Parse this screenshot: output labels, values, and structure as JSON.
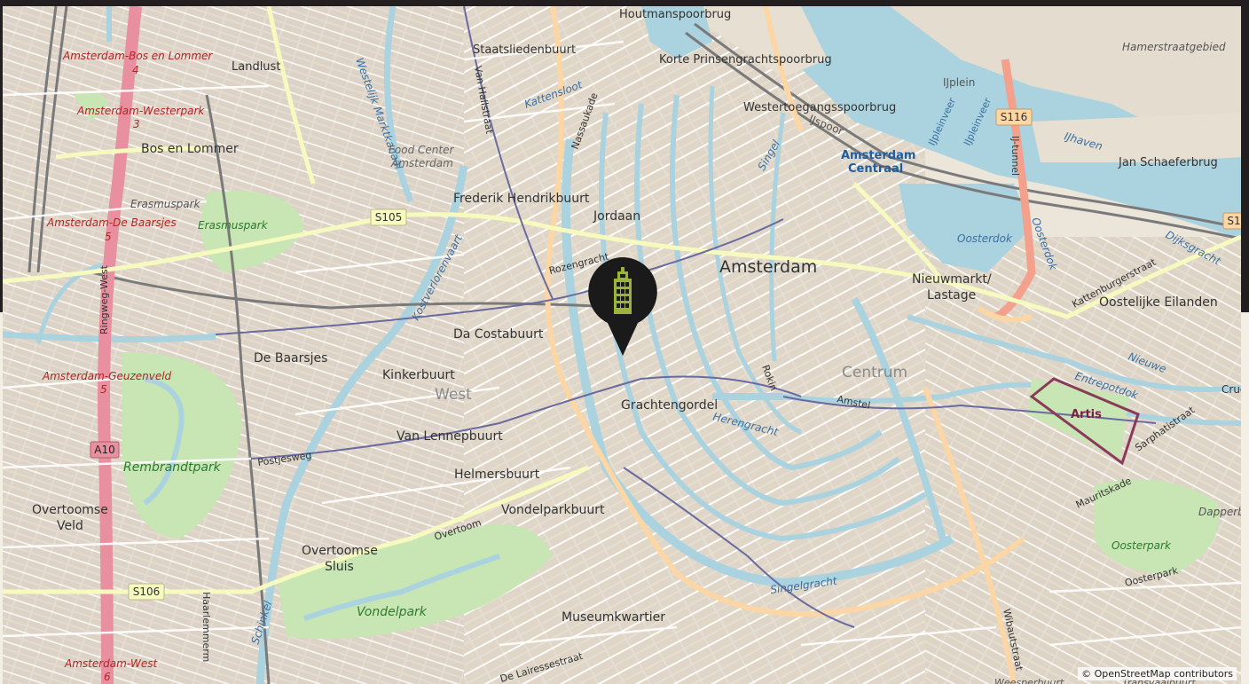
{
  "map": {
    "attribution": "© OpenStreetMap contributors",
    "marker_icon": "building-marker-icon",
    "colors": {
      "land": "#ece6da",
      "water": "#aad3df",
      "park": "#c8e5b4",
      "motorway": "#e8909f",
      "primary": "#fcd6a4",
      "secondary": "#f7fabf",
      "rail": "#7a7a7a",
      "marker": "#1a1a1a",
      "marker_icon": "#9cb33b"
    },
    "road_badges": {
      "s105": "S105",
      "s106": "S106",
      "s116": "S116",
      "a10": "A10",
      "s1": "S1"
    },
    "labels": {
      "houtmanspoorbrug": "Houtmanspoorbrug",
      "staatsliedenbuurt": "Staatsliedenbuurt",
      "landlust": "Landlust",
      "station_bos_lommer": "Amsterdam-Bos en Lommer",
      "station_bos_lommer_num": "4",
      "station_westerpark": "Amsterdam-Westerpark",
      "station_westerpark_num": "3",
      "bos_en_lommer": "Bos en Lommer",
      "erasmuspark_station": "Erasmuspark",
      "erasmuspark": "Erasmuspark",
      "station_de_baarsjes": "Amsterdam-De Baarsjes",
      "station_de_baarsjes_num": "5",
      "ringweg_west": "Ringweg-West",
      "westelijk_marktkanaal": "Westelijk Marktkanaal",
      "van_hallstraat": "Van Hallstraat",
      "food_center": "Food Center",
      "food_center_2": "Amsterdam",
      "kattensloot": "Kattensloot",
      "nassaukade": "Nassaukade",
      "korte_prinsengrachtspoorbrug": "Korte Prinsengrachtspoorbrug",
      "westertoegangsspoorbrug": "Westertoegangsspoorbrug",
      "ijspoor": "IJspoor",
      "singel": "Singel",
      "amsterdam_centraal": "Amsterdam",
      "amsterdam_centraal_2": "Centraal",
      "frederik_hendrikbuurt": "Frederik Hendrikbuurt",
      "jordaan": "Jordaan",
      "amsterdam": "Amsterdam",
      "rozengracht": "Rozengracht",
      "kostverlorenvaart": "Kostverlorenvaart",
      "da_costabuurt": "Da Costabuurt",
      "de_baarsjes": "De Baarsjes",
      "kinkerbuurt": "Kinkerbuurt",
      "west": "West",
      "station_geuzenveld": "Amsterdam-Geuzenveld",
      "station_geuzenveld_num": "5",
      "grachtengordel": "Grachtengordel",
      "rokin": "Rokin",
      "amstel": "Amstel",
      "herengracht": "Herengracht",
      "centrum": "Centrum",
      "van_lennepbuurt": "Van Lennepbuurt",
      "postjesweg": "Postjesweg",
      "rembrandtpark": "Rembrandtpark",
      "helmersbuurt": "Helmersbuurt",
      "vondelparkbuurt": "Vondelparkbuurt",
      "overtoom": "Overtoom",
      "overtoomse_veld": "Overtoomse",
      "overtoomse_veld_2": "Veld",
      "overtoomse_sluis": "Overtoomse",
      "overtoomse_sluis_2": "Sluis",
      "vondelpark": "Vondelpark",
      "schinkel": "Schinkel",
      "haarlemmermeer": "Haarlemmerm",
      "museumkwartier": "Museumkwartier",
      "de_lairessestraat": "De Lairessestraat",
      "station_amsterdam_west": "Amsterdam-West",
      "station_amsterdam_west_num": "6",
      "hamerstraatgebied": "Hamerstraatgebied",
      "ijplein": "IJplein",
      "ijtunnel": "IJ-tunnel",
      "ijhaven": "IJhaven",
      "jan_schaeferbrug": "Jan Schaeferbrug",
      "ijpleinveer": "IJpleinveer",
      "ijpleinveer_2": "IJpleinveer",
      "oosterdok": "Oosterdok",
      "oosterdok_2": "Oosterdok",
      "dijksgracht": "Dijksgracht",
      "nieuwmarkt": "Nieuwmarkt/",
      "nieuwmarkt_2": "Lastage",
      "kattenburgerstraat": "Kattenburgerstraat",
      "oostelijke_eilanden": "Oostelijke Eilanden",
      "entrepotdok": "Entrepotdok",
      "nieuwe": "Nieuwe",
      "artis": "Artis",
      "cruq": "Cruq",
      "sarphatistraat": "Sarphatistraat",
      "singelgracht": "Singelgracht",
      "mauritskade": "Mauritskade",
      "oosterpark": "Oosterpark",
      "oosterpark_street": "Oosterpark",
      "dapperbu": "Dapperbu",
      "wibautstraat": "Wibautstraat",
      "weesperbuurt": "Weesperbuurt",
      "transvaalbuurt": "Transvaalbuurt"
    }
  }
}
